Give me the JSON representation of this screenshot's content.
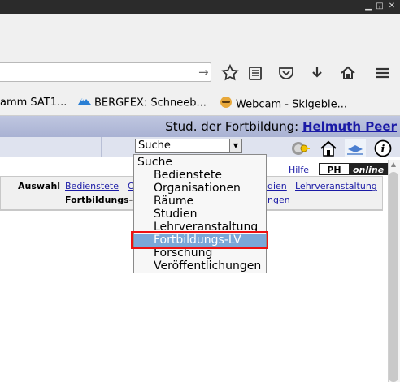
{
  "window": {
    "buttons": [
      "minimize",
      "restore",
      "close"
    ]
  },
  "navbar": {
    "url_value": ""
  },
  "bookmarks": [
    {
      "label": "amm SAT1...",
      "icon": "none"
    },
    {
      "label": "BERGFEX: Schneeb...",
      "icon": "bergfex-icon"
    },
    {
      "label": "Webcam - Skigebie...",
      "icon": "webcam-icon"
    }
  ],
  "header": {
    "prefix": "Stud. der Fortbildung:",
    "user_name": "Helmuth Peer"
  },
  "search": {
    "selected": "Suche"
  },
  "help": {
    "label": "Hilfe",
    "brand_ph": "PH",
    "brand_online": "online"
  },
  "tabs": {
    "auswahl": "Auswahl",
    "items": [
      "Bedienstete",
      "O",
      "dien",
      "Lehrveranstaltung"
    ],
    "row2_bold": "Fortbildungs-LV",
    "row2_link": "ngen"
  },
  "dropdown": {
    "options": [
      "Suche",
      "Bedienstete",
      "Organisationen",
      "Räume",
      "Studien",
      "Lehrveranstaltung",
      "Fortbildungs-LV",
      "Forschung",
      "Veröffentlichungen"
    ],
    "selected_index": 6
  },
  "colors": {
    "highlight": "#7aa7d8",
    "annotation": "#ee1111",
    "link": "#1a1aa6"
  }
}
